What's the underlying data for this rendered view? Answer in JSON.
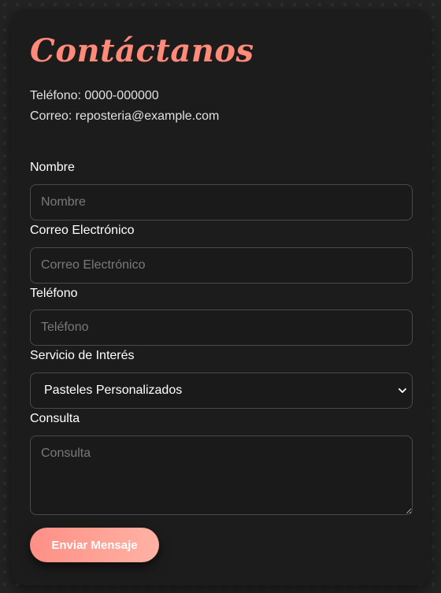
{
  "contact": {
    "title": "Contáctanos",
    "phone": "Teléfono: 0000-000000",
    "email": "Correo: reposteria@example.com"
  },
  "form": {
    "name": {
      "label": "Nombre",
      "placeholder": "Nombre",
      "value": ""
    },
    "email": {
      "label": "Correo Electrónico",
      "placeholder": "Correo Electrónico",
      "value": ""
    },
    "phone": {
      "label": "Teléfono",
      "placeholder": "Teléfono",
      "value": ""
    },
    "service": {
      "label": "Servicio de Interés",
      "selected": "Pasteles Personalizados"
    },
    "message": {
      "label": "Consulta",
      "placeholder": "Consulta",
      "value": ""
    },
    "submit_label": "Enviar Mensaje"
  },
  "icons": {
    "select_arrow": "chevron-down-icon",
    "textarea_resize": "resize-grip-icon"
  },
  "colors": {
    "accent": "#ff8a7a",
    "button_start": "#ff8f86",
    "button_end": "#ffb2a4",
    "card_bg": "#1c1c1c",
    "page_bg": "#232323",
    "field_border": "#4a4a4a"
  }
}
